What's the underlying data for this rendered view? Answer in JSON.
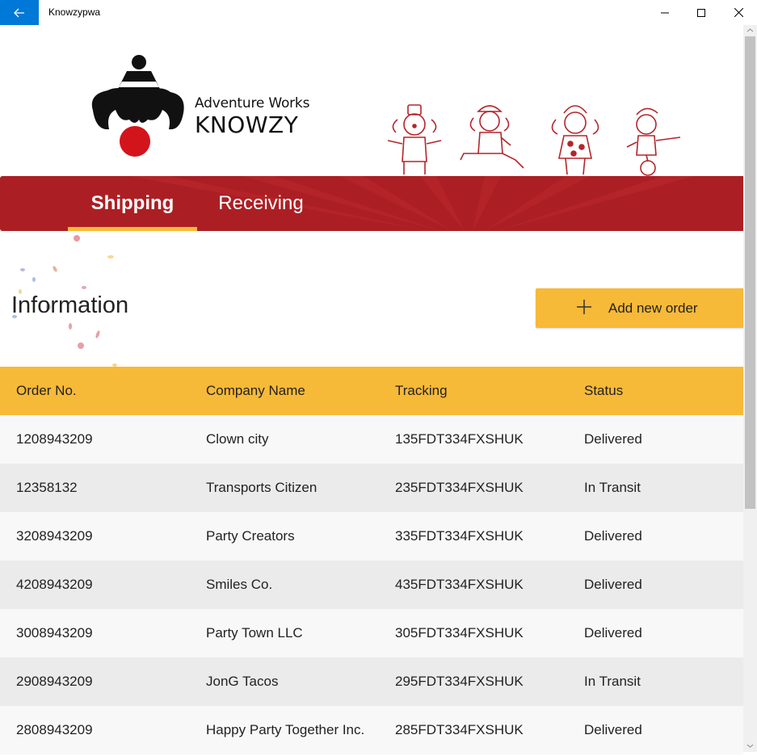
{
  "window": {
    "title": "Knowzypwa",
    "back_icon": "arrow-left-icon",
    "accent": "#0078d7"
  },
  "brand": {
    "top": "Adventure Works",
    "main": "KNOWZY"
  },
  "tabs": [
    {
      "label": "Shipping",
      "selected": true
    },
    {
      "label": "Receiving",
      "selected": false
    }
  ],
  "colors": {
    "banner": "#ab1f24",
    "accent": "#f7b938",
    "row_light": "#f8f8f8",
    "row_dark": "#ebebeb"
  },
  "main": {
    "heading": "Information",
    "add_button": "Add new order"
  },
  "table": {
    "headers": [
      "Order No.",
      "Company Name",
      "Tracking",
      "Status"
    ],
    "rows": [
      [
        "1208943209",
        "Clown city",
        "135FDT334FXSHUK",
        "Delivered"
      ],
      [
        "12358132",
        "Transports Citizen",
        "235FDT334FXSHUK",
        "In Transit"
      ],
      [
        "3208943209",
        "Party Creators",
        "335FDT334FXSHUK",
        "Delivered"
      ],
      [
        "4208943209",
        "Smiles Co.",
        "435FDT334FXSHUK",
        "Delivered"
      ],
      [
        "3008943209",
        "Party Town LLC",
        "305FDT334FXSHUK",
        "Delivered"
      ],
      [
        "2908943209",
        "JonG Tacos",
        "295FDT334FXSHUK",
        "In Transit"
      ],
      [
        "2808943209",
        "Happy Party Together Inc.",
        "285FDT334FXSHUK",
        "Delivered"
      ]
    ]
  }
}
